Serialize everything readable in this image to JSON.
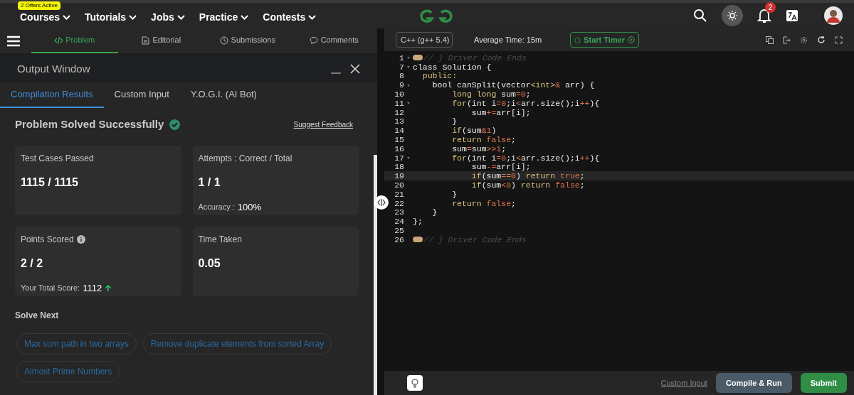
{
  "nav": {
    "items": [
      {
        "label": "Courses",
        "badge": "2 Offers Active"
      },
      {
        "label": "Tutorials"
      },
      {
        "label": "Jobs"
      },
      {
        "label": "Practice"
      },
      {
        "label": "Contests"
      }
    ],
    "notifications": "2"
  },
  "problem_tabs": [
    {
      "label": "Problem",
      "selected": true,
      "kind": "code"
    },
    {
      "label": "Editorial",
      "selected": false,
      "kind": "doc"
    },
    {
      "label": "Submissions",
      "selected": false,
      "kind": "clock"
    },
    {
      "label": "Comments",
      "selected": false,
      "kind": "chat"
    }
  ],
  "output": {
    "title": "Output Window",
    "tabs": [
      {
        "label": "Compilation Results",
        "selected": true
      },
      {
        "label": "Custom Input",
        "selected": false
      },
      {
        "label": "Y.O.G.I. (AI Bot)",
        "selected": false
      }
    ],
    "status": "Problem Solved Successfully",
    "feedback": "Suggest Feedback",
    "cards": [
      {
        "label": "Test Cases Passed",
        "value": "1115 / 1115",
        "info": false
      },
      {
        "label": "Attempts : Correct / Total",
        "value": "1 / 1",
        "info": false,
        "sub_label": "Accuracy :",
        "sub_value": "100%",
        "trend_up": false
      },
      {
        "label": "Points Scored",
        "value": "2 / 2",
        "info": true,
        "sub_label": "Your Total Score:",
        "sub_value": "1112",
        "trend_up": true
      },
      {
        "label": "Time Taken",
        "value": "0.05",
        "info": false
      }
    ],
    "solve_next": {
      "title": "Solve Next",
      "items": [
        "Max sum path in two arrays",
        "Remove duplicate elements from sorted Array",
        "Almost Prime Numbers"
      ]
    }
  },
  "editor": {
    "language": "C++ (g++ 5.4)",
    "average_time": "Average Time: 15m",
    "timer": "Start Timer",
    "lines": [
      {
        "num": "1",
        "foldable": true,
        "folded": true,
        "active": false,
        "tokens": [
          {
            "kind": "comment",
            "text": "// } Driver Code Ends"
          }
        ]
      },
      {
        "num": "7",
        "foldable": true,
        "folded": false,
        "active": false,
        "tokens": [
          {
            "kind": "plain",
            "text": "class Solution {"
          }
        ]
      },
      {
        "num": "8",
        "foldable": false,
        "folded": false,
        "active": false,
        "tokens": [
          {
            "kind": "kw",
            "text": "  public:"
          }
        ]
      },
      {
        "num": "9",
        "foldable": true,
        "folded": false,
        "active": false,
        "tokens": [
          {
            "kind": "plain",
            "text": "    bool canSplit(vector"
          },
          {
            "kind": "kw",
            "text": "<int>"
          },
          {
            "kind": "op",
            "text": "&"
          },
          {
            "kind": "plain",
            "text": " arr) {"
          }
        ]
      },
      {
        "num": "10",
        "foldable": false,
        "folded": false,
        "active": false,
        "tokens": [
          {
            "kind": "kw",
            "text": "        long long"
          },
          {
            "kind": "plain",
            "text": " sum"
          },
          {
            "kind": "op",
            "text": "="
          },
          {
            "kind": "num",
            "text": "0"
          },
          {
            "kind": "plain",
            "text": ";"
          }
        ]
      },
      {
        "num": "11",
        "foldable": true,
        "folded": false,
        "active": false,
        "tokens": [
          {
            "kind": "kw",
            "text": "        for"
          },
          {
            "kind": "plain",
            "text": "(int i"
          },
          {
            "kind": "op",
            "text": "="
          },
          {
            "kind": "num",
            "text": "0"
          },
          {
            "kind": "plain",
            "text": ";i"
          },
          {
            "kind": "op",
            "text": "<"
          },
          {
            "kind": "plain",
            "text": "arr.size();i"
          },
          {
            "kind": "op",
            "text": "++"
          },
          {
            "kind": "plain",
            "text": "){"
          }
        ]
      },
      {
        "num": "12",
        "foldable": false,
        "folded": false,
        "active": false,
        "tokens": [
          {
            "kind": "plain",
            "text": "            sum"
          },
          {
            "kind": "op",
            "text": "+="
          },
          {
            "kind": "plain",
            "text": "arr[i];"
          }
        ]
      },
      {
        "num": "13",
        "foldable": false,
        "folded": false,
        "active": false,
        "tokens": [
          {
            "kind": "plain",
            "text": "        }"
          }
        ]
      },
      {
        "num": "14",
        "foldable": false,
        "folded": false,
        "active": false,
        "tokens": [
          {
            "kind": "kw",
            "text": "        if"
          },
          {
            "kind": "plain",
            "text": "(sum"
          },
          {
            "kind": "op",
            "text": "&"
          },
          {
            "kind": "num",
            "text": "1"
          },
          {
            "kind": "plain",
            "text": ")"
          }
        ]
      },
      {
        "num": "15",
        "foldable": false,
        "folded": false,
        "active": false,
        "tokens": [
          {
            "kind": "kw",
            "text": "        return"
          },
          {
            "kind": "op",
            "text": " false"
          },
          {
            "kind": "plain",
            "text": ";"
          }
        ]
      },
      {
        "num": "16",
        "foldable": false,
        "folded": false,
        "active": false,
        "tokens": [
          {
            "kind": "plain",
            "text": "        sum"
          },
          {
            "kind": "op",
            "text": "="
          },
          {
            "kind": "plain",
            "text": "sum"
          },
          {
            "kind": "op",
            "text": ">>"
          },
          {
            "kind": "num",
            "text": "1"
          },
          {
            "kind": "plain",
            "text": ";"
          }
        ]
      },
      {
        "num": "17",
        "foldable": true,
        "folded": false,
        "active": false,
        "tokens": [
          {
            "kind": "kw",
            "text": "        for"
          },
          {
            "kind": "plain",
            "text": "(int i"
          },
          {
            "kind": "op",
            "text": "="
          },
          {
            "kind": "num",
            "text": "0"
          },
          {
            "kind": "plain",
            "text": ";i"
          },
          {
            "kind": "op",
            "text": "<"
          },
          {
            "kind": "plain",
            "text": "arr.size();i"
          },
          {
            "kind": "op",
            "text": "++"
          },
          {
            "kind": "plain",
            "text": "){"
          }
        ]
      },
      {
        "num": "18",
        "foldable": false,
        "folded": false,
        "active": false,
        "tokens": [
          {
            "kind": "plain",
            "text": "            sum"
          },
          {
            "kind": "op",
            "text": "-="
          },
          {
            "kind": "plain",
            "text": "arr[i];"
          }
        ]
      },
      {
        "num": "19",
        "foldable": false,
        "folded": false,
        "active": true,
        "tokens": [
          {
            "kind": "kw",
            "text": "            if"
          },
          {
            "kind": "plain",
            "text": "(sum"
          },
          {
            "kind": "op",
            "text": "=="
          },
          {
            "kind": "num",
            "text": "0"
          },
          {
            "kind": "plain",
            "text": ") "
          },
          {
            "kind": "kw",
            "text": "return"
          },
          {
            "kind": "op",
            "text": " true"
          },
          {
            "kind": "plain",
            "text": ";"
          }
        ]
      },
      {
        "num": "20",
        "foldable": false,
        "folded": false,
        "active": false,
        "tokens": [
          {
            "kind": "kw",
            "text": "            if"
          },
          {
            "kind": "plain",
            "text": "(sum"
          },
          {
            "kind": "op",
            "text": "<"
          },
          {
            "kind": "num",
            "text": "0"
          },
          {
            "kind": "plain",
            "text": ") "
          },
          {
            "kind": "kw",
            "text": "return"
          },
          {
            "kind": "op",
            "text": " false"
          },
          {
            "kind": "plain",
            "text": ";"
          }
        ]
      },
      {
        "num": "21",
        "foldable": false,
        "folded": false,
        "active": false,
        "tokens": [
          {
            "kind": "plain",
            "text": "        }"
          }
        ]
      },
      {
        "num": "22",
        "foldable": false,
        "folded": false,
        "active": false,
        "tokens": [
          {
            "kind": "kw",
            "text": "        return"
          },
          {
            "kind": "op",
            "text": " false"
          },
          {
            "kind": "plain",
            "text": ";"
          }
        ]
      },
      {
        "num": "23",
        "foldable": false,
        "folded": false,
        "active": false,
        "tokens": [
          {
            "kind": "plain",
            "text": "    }"
          }
        ]
      },
      {
        "num": "24",
        "foldable": false,
        "folded": false,
        "active": false,
        "tokens": [
          {
            "kind": "plain",
            "text": "};"
          }
        ]
      },
      {
        "num": "25",
        "foldable": false,
        "folded": false,
        "active": false
      },
      {
        "num": "26",
        "foldable": false,
        "folded": true,
        "active": false,
        "tokens": [
          {
            "kind": "comment",
            "text": "// } Driver Code Ends"
          }
        ]
      }
    ],
    "custom_input": "Custom Input",
    "compile": "Compile & Run",
    "submit": "Submit"
  }
}
